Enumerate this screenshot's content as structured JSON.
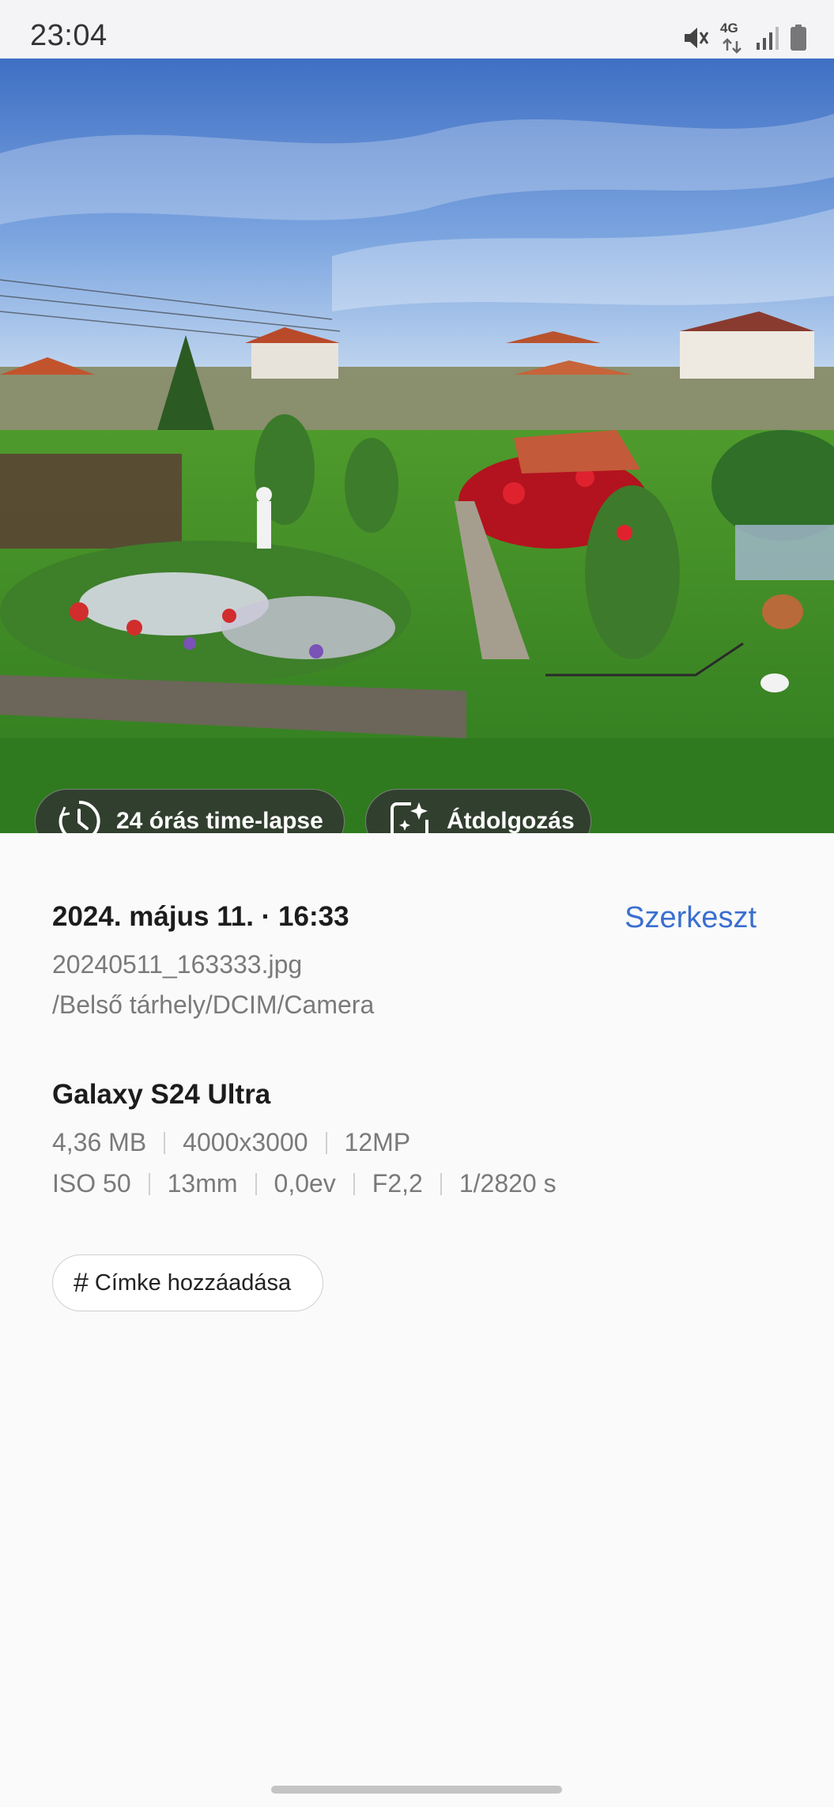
{
  "status_bar": {
    "time": "23:04",
    "network": "4G",
    "icons": [
      "mute-icon",
      "4g-data-icon",
      "signal-icon",
      "battery-icon"
    ]
  },
  "photo": {
    "buttons": {
      "timelapse_label": "24 órás time-lapse",
      "remaster_label": "Átdolgozás"
    }
  },
  "details": {
    "date": "2024. május 11. · 16:33",
    "edit_label": "Szerkeszt",
    "filename": "20240511_163333.jpg",
    "path": "/Belső tárhely/DCIM/Camera",
    "device": "Galaxy S24 Ultra",
    "file_meta": [
      "4,36 MB",
      "4000x3000",
      "12MP"
    ],
    "camera_meta": [
      "ISO 50",
      "13mm",
      "0,0ev",
      "F2,2",
      "1/2820 s"
    ]
  },
  "tags": {
    "add_label": "Címke hozzáadása"
  },
  "colors": {
    "accent": "#3a6fd0",
    "background": "#fafafa"
  }
}
